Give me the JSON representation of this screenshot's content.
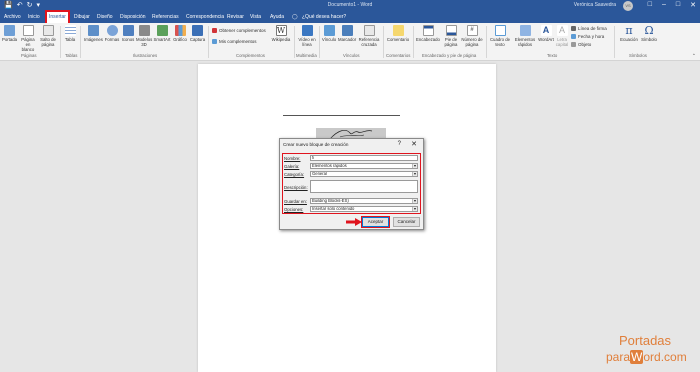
{
  "app": {
    "title": "Documento1 - Word",
    "user": "Verónica Saavedra",
    "avatar_initials": "VS",
    "qat": [
      "save-icon",
      "undo-icon",
      "redo-icon",
      "customize-icon"
    ],
    "window_buttons": [
      "ribbon-display-icon",
      "minimize-icon",
      "maximize-icon",
      "close-icon"
    ]
  },
  "tabs": [
    "Archivo",
    "Inicio",
    "Insertar",
    "Dibujar",
    "Diseño",
    "Disposición",
    "Referencias",
    "Correspondencia",
    "Revisar",
    "Vista",
    "Ayuda",
    "¿Qué desea hacer?"
  ],
  "active_tab": "Insertar",
  "ribbon": {
    "paginas": {
      "label": "Páginas",
      "buttons": [
        "Portada",
        "Página en blanco",
        "Salto de página"
      ]
    },
    "tablas": {
      "label": "Tablas",
      "buttons": [
        "Tabla"
      ]
    },
    "ilustraciones": {
      "label": "Ilustraciones",
      "buttons": [
        "Imágenes",
        "Formas",
        "Iconos",
        "Modelos 3D",
        "SmartArt",
        "Gráfico",
        "Captura"
      ]
    },
    "complementos": {
      "label": "Complementos",
      "items": [
        "Obtener complementos",
        "Mis complementos",
        "Wikipedia"
      ]
    },
    "multimedia": {
      "label": "Multimedia",
      "buttons": [
        "Vídeo en línea"
      ]
    },
    "vinculos": {
      "label": "Vínculos",
      "buttons": [
        "Vínculo",
        "Marcador",
        "Referencia cruzada"
      ]
    },
    "comentarios": {
      "label": "Comentarios",
      "buttons": [
        "Comentario"
      ]
    },
    "encabezado": {
      "label": "Encabezado y pie de página",
      "buttons": [
        "Encabezado",
        "Pie de página",
        "Número de página"
      ]
    },
    "texto": {
      "label": "Texto",
      "buttons": [
        "Cuadro de texto",
        "Elementos rápidos",
        "WordArt",
        "Letra capital"
      ],
      "items": [
        "Línea de firma",
        "Fecha y hora",
        "Objeto"
      ]
    },
    "simbolos": {
      "label": "Símbolos",
      "buttons": [
        "Ecuación",
        "Símbolo"
      ],
      "glyphs": [
        "π",
        "Ω"
      ]
    }
  },
  "dialog": {
    "title": "Crear nuevo bloque de creación",
    "help": "?",
    "close": "✕",
    "fields": {
      "nombre": {
        "label": "Nombre:",
        "value": "fi"
      },
      "galeria": {
        "label": "Galería:",
        "value": "Elementos rápidos"
      },
      "categoria": {
        "label": "Categoría:",
        "value": "General"
      },
      "descripcion": {
        "label": "Descripción:",
        "value": ""
      },
      "guardar": {
        "label": "Guardar en:",
        "value": "Building Blocks-ES)"
      },
      "opciones": {
        "label": "Opciones:",
        "value": "Insertar solo contenido"
      }
    },
    "ok": "Aceptar",
    "cancel": "Cancelar"
  },
  "watermark": {
    "line1": "Portadas",
    "line2_a": "para",
    "line2_b": "W",
    "line2_c": "ord.com"
  },
  "colors": {
    "word_blue": "#2b579a",
    "highlight_red": "#e0141e",
    "brand_orange": "#e07f3b"
  }
}
